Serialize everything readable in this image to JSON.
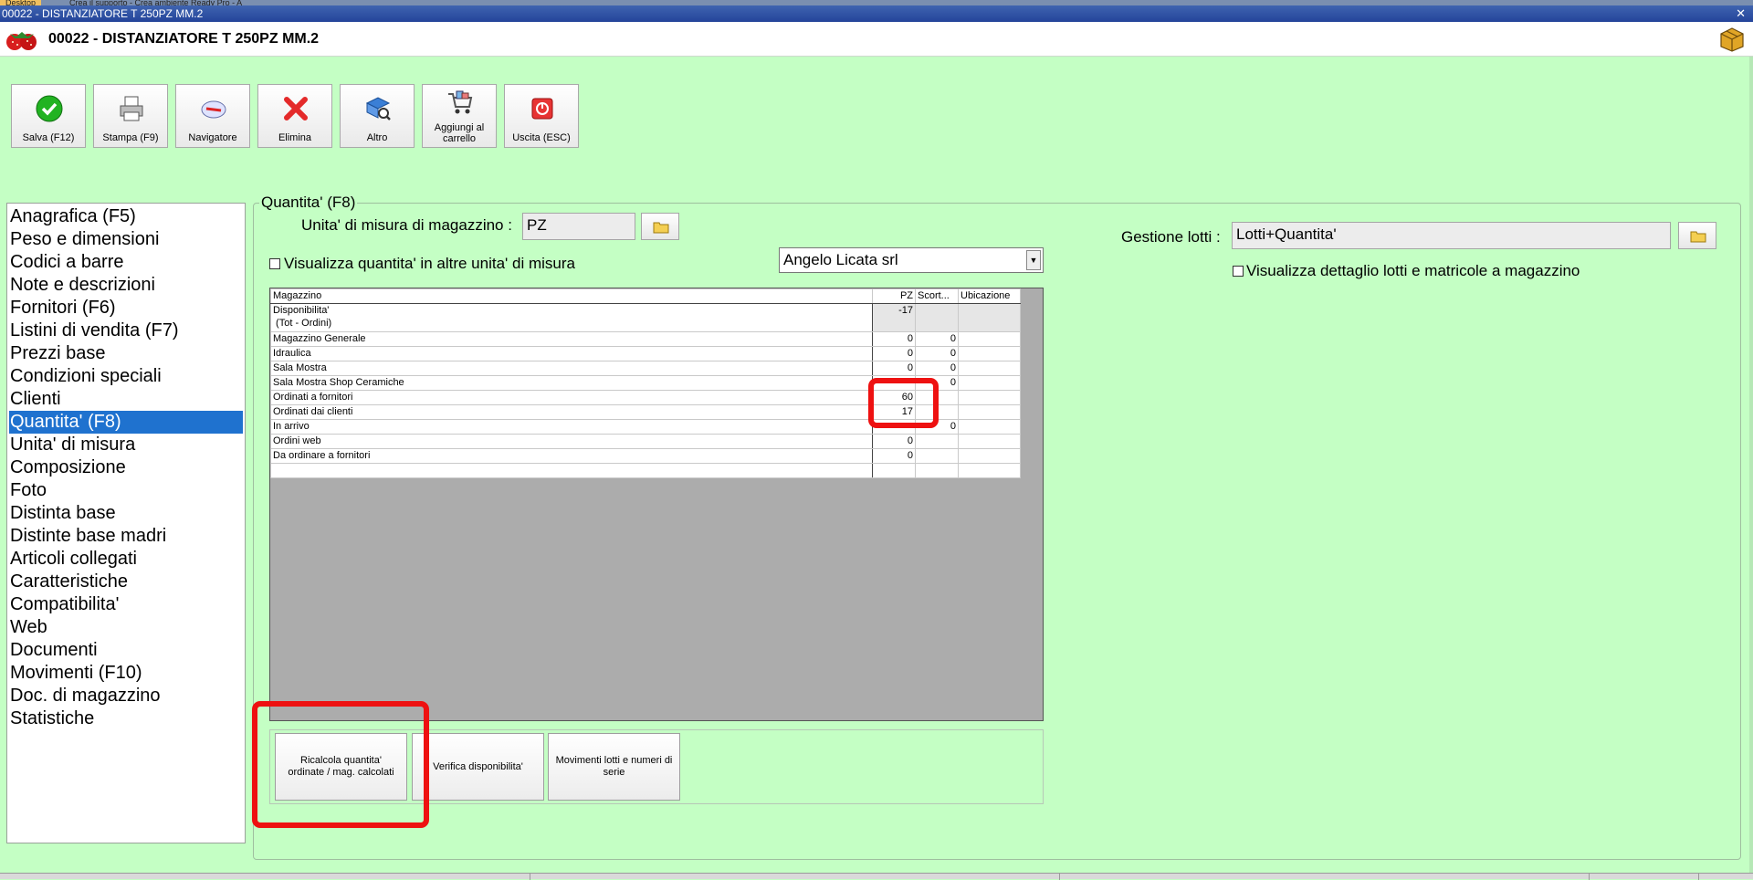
{
  "window": {
    "title": "00022 - DISTANZIATORE T 250PZ MM.2",
    "top_tabs": [
      "Desktop",
      "Crea il supporto - Crea ambiente Ready Pro - A"
    ]
  },
  "header": {
    "title": "00022 - DISTANZIATORE T 250PZ MM.2"
  },
  "toolbar": [
    {
      "label": "Salva (F12)",
      "icon": "check-icon"
    },
    {
      "label": "Stampa (F9)",
      "icon": "printer-icon"
    },
    {
      "label": "Navigatore",
      "icon": "compass-icon"
    },
    {
      "label": "Elimina",
      "icon": "delete-x-icon"
    },
    {
      "label": "Altro",
      "icon": "book-search-icon"
    },
    {
      "label": "Aggiungi al carrello",
      "icon": "cart-icon"
    },
    {
      "label": "Uscita (ESC)",
      "icon": "exit-icon"
    }
  ],
  "sidebar": {
    "items": [
      "Anagrafica (F5)",
      "Peso e dimensioni",
      "Codici a barre",
      "Note e descrizioni",
      "Fornitori (F6)",
      "Listini di vendita (F7)",
      "Prezzi base",
      "Condizioni speciali",
      "Clienti",
      "Quantita' (F8)",
      "Unita' di misura",
      "Composizione",
      "Foto",
      "Distinta base",
      "Distinte base madri",
      "Articoli collegati",
      "Caratteristiche",
      "Compatibilita'",
      "Web",
      "Documenti",
      "Movimenti (F10)",
      "Doc. di magazzino",
      "Statistiche"
    ],
    "selected": "Quantita' (F8)"
  },
  "panel": {
    "group_title": "Quantita' (F8)",
    "um_label": "Unita' di misura di magazzino :",
    "um_value": "PZ",
    "show_other_units_label": "Visualizza quantita' in altre unita' di misura",
    "company_select": "Angelo Licata srl",
    "lotti_label": "Gestione lotti :",
    "lotti_value": "Lotti+Quantita'",
    "show_lotti_label": "Visualizza dettaglio lotti e matricole a magazzino"
  },
  "grid": {
    "headers": [
      "Magazzino",
      "PZ",
      "Scort...",
      "Ubicazione"
    ],
    "rows": [
      {
        "name": "Disponibilita'",
        "name2": " (Tot - Ordini)",
        "pz": "-17",
        "scorta": "",
        "ubicazione": ""
      },
      {
        "name": "Magazzino Generale",
        "pz": "0",
        "scorta": "0",
        "ubicazione": ""
      },
      {
        "name": "Idraulica",
        "pz": "0",
        "scorta": "0",
        "ubicazione": ""
      },
      {
        "name": "Sala Mostra",
        "pz": "0",
        "scorta": "0",
        "ubicazione": ""
      },
      {
        "name": "Sala Mostra Shop Ceramiche",
        "pz": "",
        "scorta": "0",
        "ubicazione": ""
      },
      {
        "name": "Ordinati a fornitori",
        "pz": "60",
        "scorta": "",
        "ubicazione": ""
      },
      {
        "name": "Ordinati dai clienti",
        "pz": "17",
        "scorta": "",
        "ubicazione": ""
      },
      {
        "name": "In arrivo",
        "pz": "",
        "scorta": "0",
        "ubicazione": ""
      },
      {
        "name": "Ordini web",
        "pz": "0",
        "scorta": "",
        "ubicazione": ""
      },
      {
        "name": "Da ordinare a fornitori",
        "pz": "0",
        "scorta": "",
        "ubicazione": ""
      },
      {
        "name": "",
        "pz": "",
        "scorta": "",
        "ubicazione": ""
      }
    ]
  },
  "actions": {
    "recalc": "Ricalcola quantita' ordinate / mag. calcolati",
    "verify": "Verifica disponibilita'",
    "lots": "Movimenti lotti e numeri di serie"
  },
  "colors": {
    "background": "#c4ffc4",
    "selection": "#1f72cf",
    "highlight": "#ee1111"
  }
}
